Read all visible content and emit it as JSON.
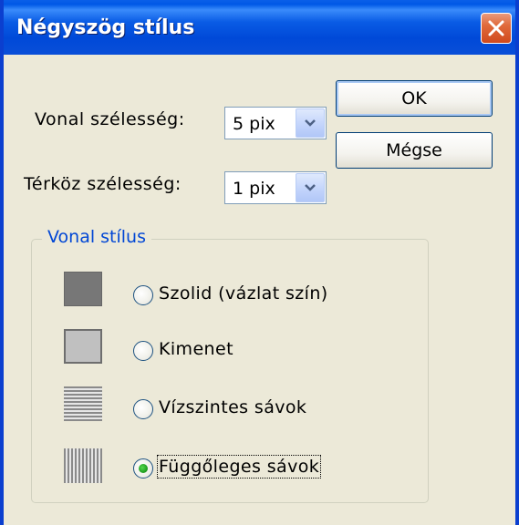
{
  "window": {
    "title": "Négyszög stílus"
  },
  "form": {
    "line_width_label": "Vonal szélesség:",
    "line_width_value": "5 pix",
    "gap_width_label": "Térköz szélesség:",
    "gap_width_value": "1 pix"
  },
  "buttons": {
    "ok": "OK",
    "cancel": "Mégse"
  },
  "line_style": {
    "legend": "Vonal stílus",
    "options": [
      {
        "label": "Szolid (vázlat szín)",
        "icon": "solid-swatch-icon",
        "selected": false
      },
      {
        "label": "Kimenet",
        "icon": "outline-swatch-icon",
        "selected": false
      },
      {
        "label": "Vízszintes sávok",
        "icon": "horizontal-stripes-icon",
        "selected": false
      },
      {
        "label": "Függőleges sávok",
        "icon": "vertical-stripes-icon",
        "selected": true
      }
    ]
  },
  "colors": {
    "titlebar": "#0058e6",
    "dialog_bg": "#ece9d8",
    "legend": "#0046d5",
    "close": "#e06a3b"
  }
}
